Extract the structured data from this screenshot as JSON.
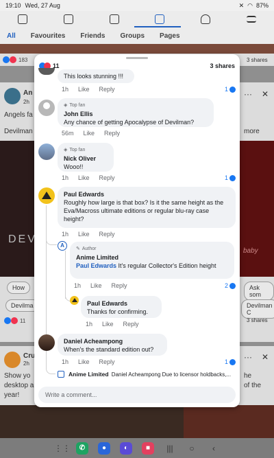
{
  "statusbar": {
    "time": "19:10",
    "date": "Wed, 27 Aug",
    "battery": "87%"
  },
  "filters": [
    "All",
    "Favourites",
    "Friends",
    "Groups",
    "Pages"
  ],
  "feed": {
    "top_reactions": "183",
    "top_shares": "3 shares",
    "post1_name": "An",
    "post1_time": "2h",
    "post1_text": "Angels fa",
    "post1_text2": "Devilman",
    "post1_more": "more",
    "post1_banner": "DEV",
    "chip_how": "How",
    "chip_askso": "Ask som",
    "chip_devilman_left": "Devilma",
    "chip_devilman_right": "Devilman C",
    "post1_reactions": "11",
    "post1_shares": "3 shares",
    "post2_name": "Cru",
    "post2_time": "2h",
    "post2_text": "Show yo",
    "post2_text2": "desktop a",
    "post2_text3": "year!",
    "post2_right1": "he",
    "post2_right2": "of the",
    "post2_right3": "baby"
  },
  "sheet": {
    "reaction_count": "11",
    "shares": "3 shares",
    "comments": [
      {
        "text": "This looks stunning !!!",
        "time": "1h",
        "like": "Like",
        "reply": "Reply",
        "likes": "1"
      },
      {
        "badge": "Top fan",
        "name": "John Ellis",
        "text": "Any chance of getting Apocalypse of Devilman?",
        "time": "56m",
        "like": "Like",
        "reply": "Reply"
      },
      {
        "badge": "Top fan",
        "name": "Nick Oliver",
        "text": "Wooo!!",
        "time": "1h",
        "like": "Like",
        "reply": "Reply",
        "likes": "1"
      },
      {
        "name": "Paul Edwards",
        "text": "Roughly how large is that box? Is it the same height as the Eva/Macross ultimate editions or regular blu-ray case height?",
        "time": "1h",
        "like": "Like",
        "reply": "Reply"
      },
      {
        "badge": "Author",
        "name": "Anime Limited",
        "mention": "Paul Edwards",
        "text": " It's regular Collector's Edition height",
        "time": "1h",
        "like": "Like",
        "reply": "Reply",
        "likes": "2"
      },
      {
        "name": "Paul Edwards",
        "text": "Thanks for confirming.",
        "time": "1h",
        "like": "Like",
        "reply": "Reply"
      },
      {
        "name": "Daniel Acheampong",
        "text": "When's the standard edition out?",
        "time": "1h",
        "like": "Like",
        "reply": "Reply",
        "likes": "1"
      },
      {
        "name": "Anime Limited",
        "text": "Daniel Acheampong Due to licensor holdbacks,..."
      }
    ],
    "input_placeholder": "Write a comment..."
  },
  "colors": {
    "accent": "#1877f2",
    "brand_nav": "#1f5fbf"
  }
}
